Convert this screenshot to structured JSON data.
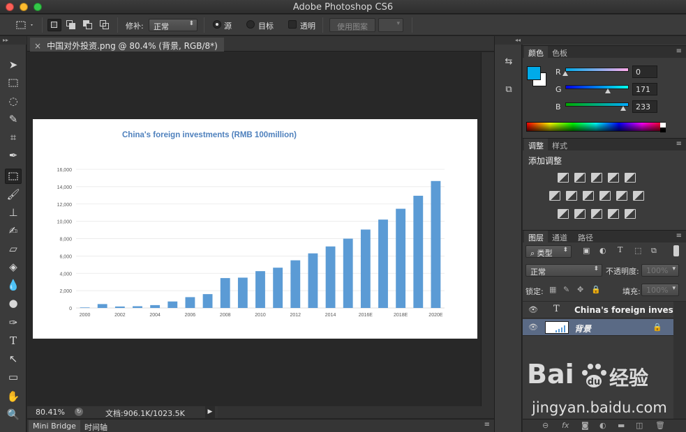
{
  "window": {
    "title": "Adobe Photoshop CS6"
  },
  "options_bar": {
    "patch_label": "修补:",
    "patch_value": "正常",
    "source_label": "源",
    "target_label": "目标",
    "transparent_label": "透明",
    "use_pattern_label": "使用图案"
  },
  "document": {
    "tab_title": "中国对外投资.png @ 80.4% (背景, RGB/8*) *",
    "zoom": "80.41%",
    "doc_info": "文档:906.1K/1023.5K"
  },
  "bottom_tabs": [
    "Mini Bridge",
    "时间轴"
  ],
  "chart_data": {
    "type": "bar",
    "title": "China's foreign investments (RMB 100million)",
    "categories": [
      "2000",
      "2001",
      "2002",
      "2003",
      "2004",
      "2005",
      "2006",
      "2007",
      "2008",
      "2009",
      "2010",
      "2011",
      "2012",
      "2013",
      "2014",
      "2015",
      "2016E",
      "2017E",
      "2018E",
      "2019E",
      "2020E"
    ],
    "tick_labels_x": [
      "2000",
      "2002",
      "2004",
      "2006",
      "2008",
      "2010",
      "2012",
      "2014",
      "2016E",
      "2018E",
      "2020E"
    ],
    "values": [
      60,
      450,
      170,
      200,
      330,
      750,
      1250,
      1600,
      3450,
      3500,
      4250,
      4650,
      5500,
      6300,
      7100,
      8000,
      9050,
      10200,
      11450,
      12950,
      14650
    ],
    "ylim": [
      0,
      16000
    ],
    "yticks": [
      "16,000",
      "14,000",
      "12,000",
      "10,000",
      "8,000",
      "6,000",
      "4,000",
      "2,000",
      "0"
    ],
    "bar_color": "#5b9bd5",
    "title_color": "#4f81bd",
    "grid": true
  },
  "color_panel": {
    "tabs": [
      "颜色",
      "色板"
    ],
    "r_label": "R",
    "g_label": "G",
    "b_label": "B",
    "r": "0",
    "g": "171",
    "b": "233",
    "r_frac": 0.0,
    "g_frac": 0.67,
    "b_frac": 0.91,
    "foreground": "#00abe9",
    "background": "#ffffff"
  },
  "adjust_panel": {
    "tabs": [
      "调整",
      "样式"
    ],
    "title": "添加调整"
  },
  "layers_panel": {
    "tabs": [
      "图层",
      "通道",
      "路径"
    ],
    "filter_label": "类型",
    "blend_mode": "正常",
    "opacity_label": "不透明度:",
    "opacity_value": "100%",
    "lock_label": "锁定:",
    "fill_label": "填充:",
    "fill_value": "100%",
    "layers": [
      {
        "name": "China's foreign invest...",
        "kind": "T"
      },
      {
        "name": "背景"
      }
    ]
  },
  "watermark": {
    "brand": "Bai",
    "brand2": "经验",
    "url": "jingyan.baidu.com"
  }
}
